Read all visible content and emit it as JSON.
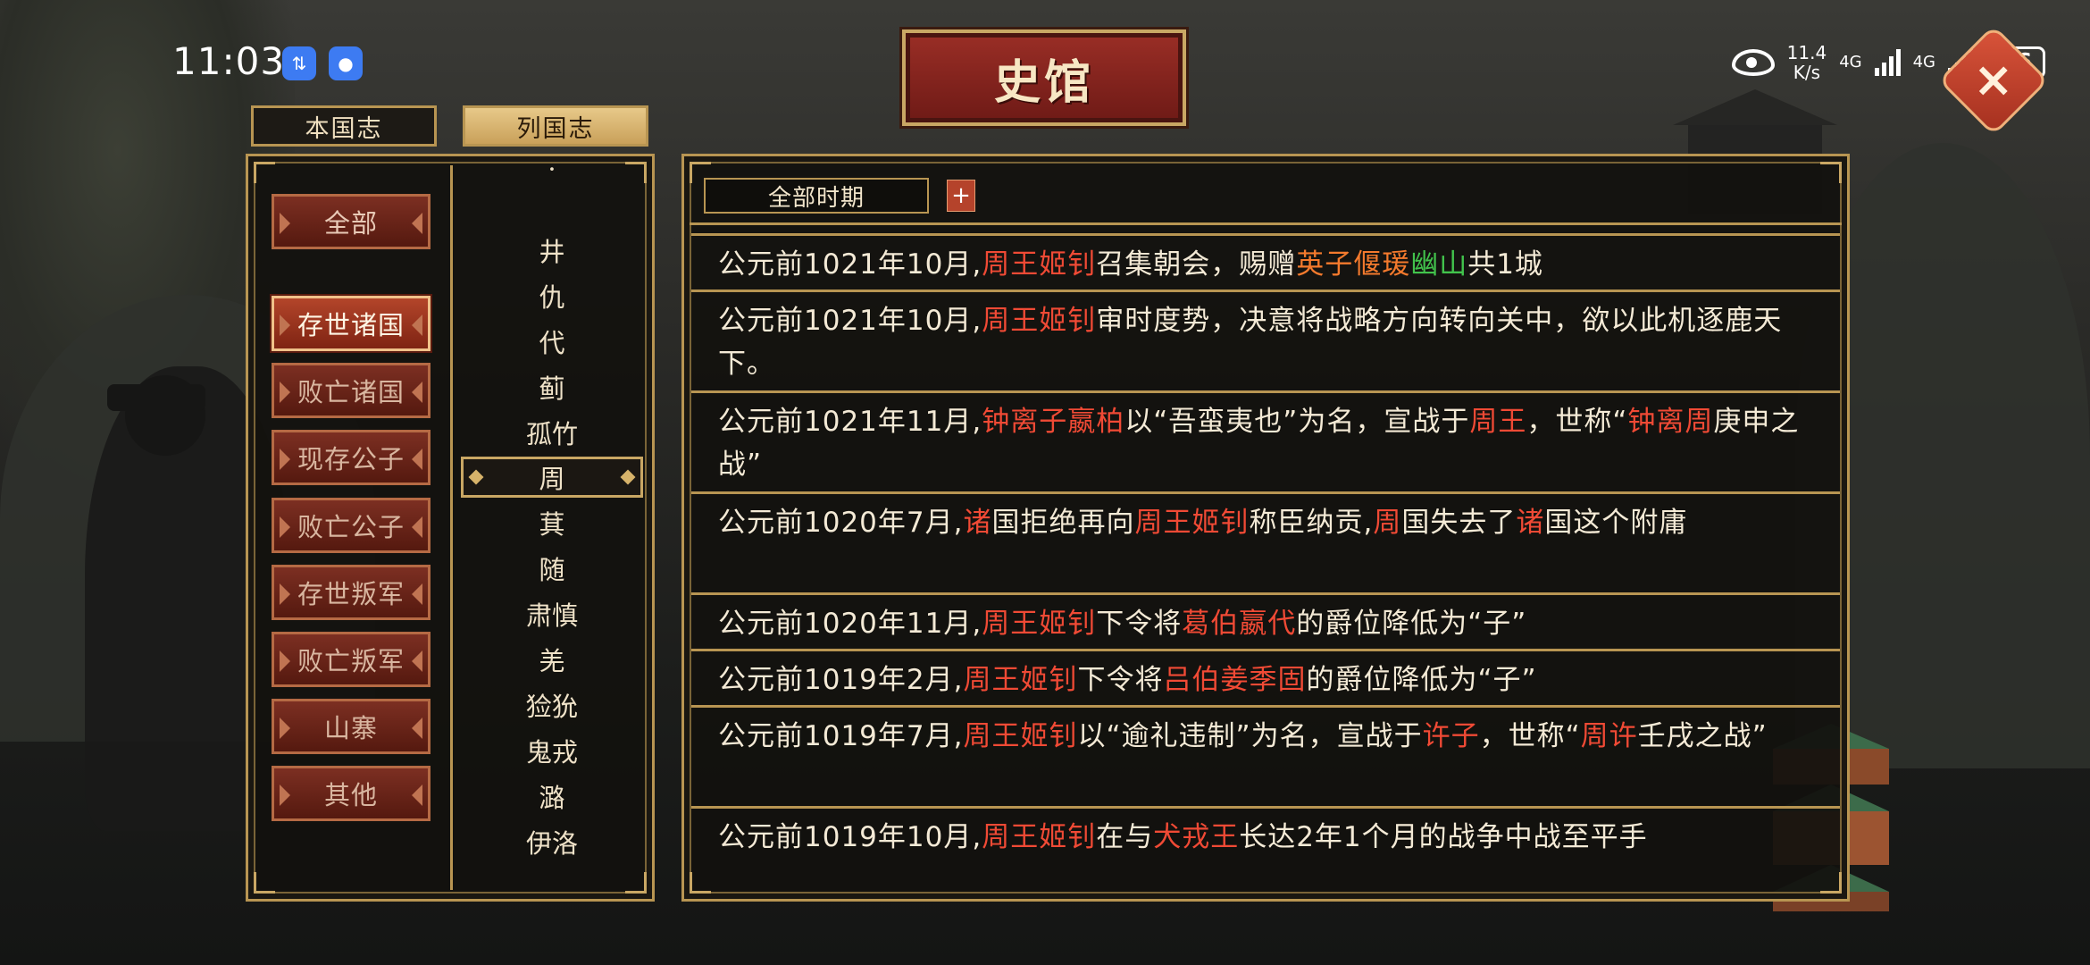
{
  "status_bar": {
    "time": "11:03",
    "badge1_icon": "transfer-icon",
    "badge2_icon": "chat-icon",
    "speed_top": "11.4",
    "speed_bottom": "K/s",
    "net1": "4G",
    "net2": "4G",
    "battery": "16"
  },
  "header": {
    "title": "史馆",
    "close_icon": "close-icon"
  },
  "top_tabs": [
    {
      "label": "本国志",
      "active": false
    },
    {
      "label": "列国志",
      "active": true
    }
  ],
  "categories": [
    {
      "label": "全部"
    },
    {
      "label": "存世诸国"
    },
    {
      "label": "败亡诸国"
    },
    {
      "label": "现存公子"
    },
    {
      "label": "败亡公子"
    },
    {
      "label": "存世叛军"
    },
    {
      "label": "败亡叛军"
    },
    {
      "label": "山寨"
    },
    {
      "label": "其他"
    }
  ],
  "countries": [
    "井",
    "仇",
    "代",
    "蓟",
    "孤竹",
    "周",
    "萁",
    "随",
    "肃慎",
    "羌",
    "猃狁",
    "鬼戎",
    "潞",
    "伊洛"
  ],
  "selected_country": "周",
  "filter": {
    "period": "全部时期",
    "add_label": "+"
  },
  "records": [
    {
      "segments": [
        [
          "公元前1021年10月,",
          ""
        ],
        [
          "周王姬钊",
          "r"
        ],
        [
          "召集朝会，赐赠",
          ""
        ],
        [
          "英子偃瑗",
          "o"
        ],
        [
          "幽山",
          "g"
        ],
        [
          "共1城",
          ""
        ]
      ]
    },
    {
      "segments": [
        [
          "公元前1021年10月,",
          ""
        ],
        [
          "周王姬钊",
          "r"
        ],
        [
          "审时度势，决意将战略方向转向关中，欲以此机逐鹿天下。",
          ""
        ]
      ]
    },
    {
      "segments": [
        [
          "公元前1021年11月,",
          ""
        ],
        [
          "钟离子嬴柏",
          "r"
        ],
        [
          "以“吾蛮夷也”为名，宣战于",
          ""
        ],
        [
          "周王",
          "r"
        ],
        [
          "，世称“",
          ""
        ],
        [
          "钟离周",
          "r"
        ],
        [
          "庚申之战”",
          ""
        ]
      ]
    },
    {
      "segments": [
        [
          "公元前1020年7月,",
          ""
        ],
        [
          "诸",
          "r"
        ],
        [
          "国拒绝再向",
          ""
        ],
        [
          "周王姬钊",
          "r"
        ],
        [
          "称臣纳贡,",
          ""
        ],
        [
          "周",
          "r"
        ],
        [
          "国失去了",
          ""
        ],
        [
          "诸",
          "r"
        ],
        [
          "国这个附庸",
          ""
        ]
      ]
    },
    {
      "segments": [
        [
          "公元前1020年11月,",
          ""
        ],
        [
          "周王姬钊",
          "r"
        ],
        [
          "下令将",
          ""
        ],
        [
          "葛伯嬴代",
          "r"
        ],
        [
          "的爵位降低为“子”",
          ""
        ]
      ]
    },
    {
      "segments": [
        [
          "公元前1019年2月,",
          ""
        ],
        [
          "周王姬钊",
          "r"
        ],
        [
          "下令将",
          ""
        ],
        [
          "吕伯姜季固",
          "r"
        ],
        [
          "的爵位降低为“子”",
          ""
        ]
      ]
    },
    {
      "segments": [
        [
          "公元前1019年7月,",
          ""
        ],
        [
          "周王姬钊",
          "r"
        ],
        [
          "以“逾礼违制”为名，宣战于",
          ""
        ],
        [
          "许子",
          "r"
        ],
        [
          "，世称“",
          ""
        ],
        [
          "周许",
          "r"
        ],
        [
          "壬戌之战”",
          ""
        ]
      ]
    },
    {
      "segments": [
        [
          "公元前1019年10月,",
          ""
        ],
        [
          "周王姬钊",
          "r"
        ],
        [
          "在与",
          ""
        ],
        [
          "犬戎王",
          "r"
        ],
        [
          "长达2年1个月的战争中战至平手",
          ""
        ]
      ]
    }
  ]
}
